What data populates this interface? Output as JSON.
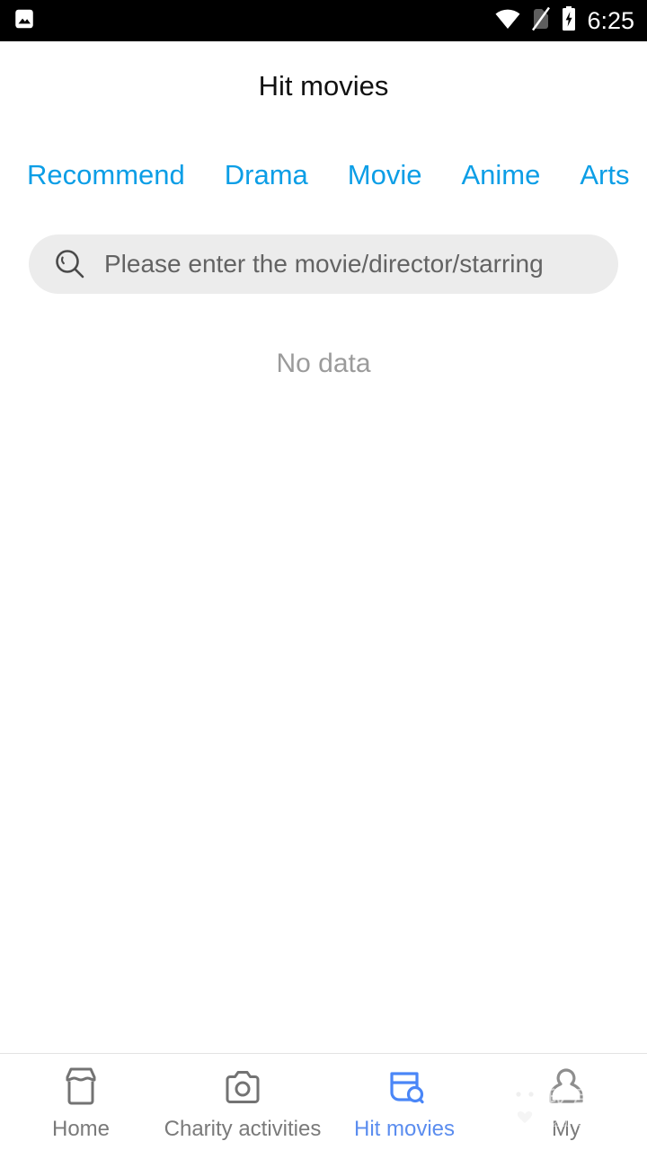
{
  "status_bar": {
    "notification_icon": "image-icon",
    "wifi_icon": "wifi-icon",
    "sim_icon": "no-sim-icon",
    "battery_icon": "battery-charging-icon",
    "time": "6:25"
  },
  "header": {
    "title": "Hit movies"
  },
  "tabs": {
    "active_color": "#0c9ee6",
    "items": [
      {
        "label": "Recommend"
      },
      {
        "label": "Drama"
      },
      {
        "label": "Movie"
      },
      {
        "label": "Anime"
      },
      {
        "label": "Arts"
      }
    ]
  },
  "search": {
    "icon": "search-icon",
    "placeholder": "Please enter the movie/director/starring",
    "value": ""
  },
  "content": {
    "empty_text": "No data"
  },
  "bottom_nav": {
    "active_color": "#5b8def",
    "inactive_color": "#7a7a7a",
    "items": [
      {
        "label": "Home",
        "icon": "shop-icon"
      },
      {
        "label": "Charity activities",
        "icon": "camera-icon"
      },
      {
        "label": "Hit movies",
        "icon": "browser-search-icon"
      },
      {
        "label": "My",
        "icon": "person-icon"
      }
    ]
  },
  "watermark": {
    "text_cn": "我爱安卓",
    "text_url": "52android.com",
    "mascot": "android-robot-icon"
  }
}
